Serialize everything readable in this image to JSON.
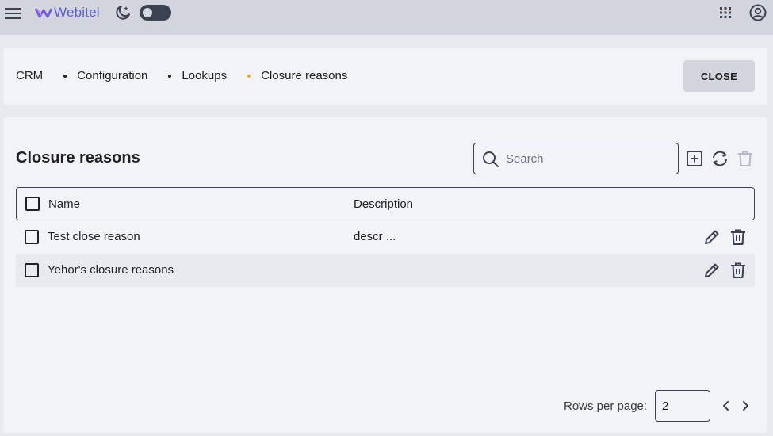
{
  "header": {
    "logo_text": "Webitel",
    "brand_color": "#5f5bd6",
    "icons": [
      "menu-icon",
      "logo-icon",
      "moon-icon",
      "apps-grid-icon",
      "account-icon"
    ],
    "theme_toggle_on": false
  },
  "breadcrumb": {
    "items": [
      "CRM",
      "Configuration",
      "Lookups",
      "Closure reasons"
    ],
    "active_dot_color": "#f4a81d"
  },
  "close_button": {
    "label": "CLOSE"
  },
  "main": {
    "title": "Closure reasons",
    "search": {
      "placeholder": "Search",
      "value": ""
    },
    "toolbar_icons": [
      "add-icon",
      "refresh-icon",
      "delete-icon"
    ]
  },
  "table": {
    "columns": [
      "Name",
      "Description"
    ],
    "rows": [
      {
        "name": "Test close reason",
        "description": "descr ..."
      },
      {
        "name": "Yehor's closure reasons",
        "description": ""
      }
    ]
  },
  "pagination": {
    "rows_per_page_label": "Rows per page:",
    "rows_per_page": "2"
  }
}
